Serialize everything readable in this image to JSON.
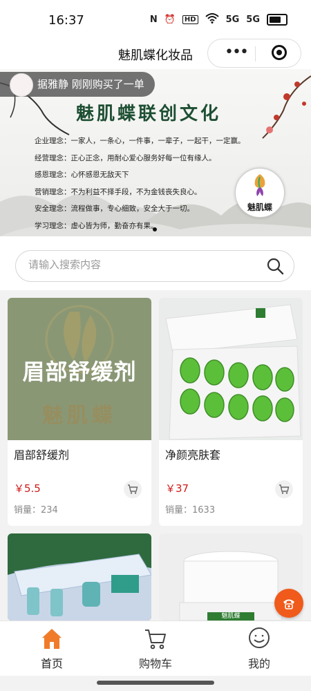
{
  "status_bar": {
    "time": "16:37",
    "icons": [
      "nfc-icon",
      "alarm-icon",
      "hd-icon",
      "wifi-icon",
      "signal-5g-icon",
      "signal-5g-icon",
      "battery-icon"
    ],
    "labels": {
      "nfc": "N",
      "hd": "HD",
      "five_g_1": "5G",
      "five_g_2": "5G"
    }
  },
  "nav": {
    "title": "魅肌蝶化妆品"
  },
  "notice": {
    "text": "据雅静 刚刚购买了一单"
  },
  "banner": {
    "title": "魅肌蝶联创文化",
    "lines": [
      "企业理念：一家人，一条心，一件事，一辈子，一起干，一定赢。",
      "经营理念：正心正念，用耐心爱心服务好每一位有缘人。",
      "感恩理念：心怀感恩无敌天下",
      "营销理念：不为利益不择手段，不为金钱丧失良心。",
      "安全理念：流程做事，专心细致，安全大于一切。",
      "学习理念：虚心皆为师，勤奋亦有果。"
    ],
    "seal_text": "魅肌蝶",
    "pager": {
      "count": 1,
      "active": 0
    }
  },
  "search": {
    "placeholder": "请输入搜索内容"
  },
  "products": [
    {
      "name": "眉部舒缓剂",
      "price": "￥5.5",
      "sales": "销量：234",
      "image_text": "眉部舒缓剂",
      "image_brand": "魅肌蝶"
    },
    {
      "name": "净颜亮肤套",
      "price": "￥37",
      "sales": "销量：1633"
    },
    {
      "name": "",
      "price": "",
      "sales": ""
    },
    {
      "name": "",
      "price": "",
      "sales": "",
      "image_label": "魅肌蝶"
    }
  ],
  "tabs": [
    {
      "label": "首页",
      "icon": "home-icon",
      "active": true
    },
    {
      "label": "购物车",
      "icon": "cart-icon",
      "active": false
    },
    {
      "label": "我的",
      "icon": "profile-icon",
      "active": false
    }
  ],
  "colors": {
    "accent": "#f07c2a",
    "price": "#d01a1a",
    "fab": "#f05a1a",
    "banner_title": "#1e4f33"
  }
}
